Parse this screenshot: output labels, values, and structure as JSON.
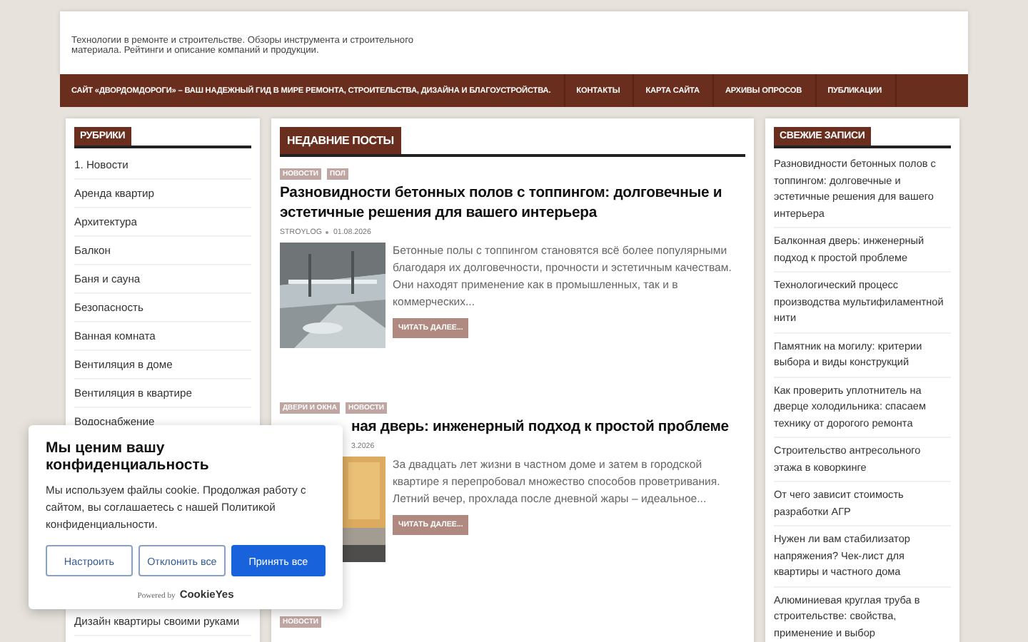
{
  "header": {
    "tagline": "Технологии в ремонте и строительстве. Обзоры инструмента и строительного материала. Рейтинги и описание компаний и продукции."
  },
  "nav": {
    "items": [
      {
        "label": "САЙТ «ДВОРДОМДОРОГИ» – ВАШ НАДЕЖНЫЙ ГИД В МИРЕ РЕМОНТА, СТРОИТЕЛЬСТВА, ДИЗАЙНА И БЛАГОУСТРОЙСТВА."
      },
      {
        "label": "КОНТАКТЫ"
      },
      {
        "label": "КАРТА САЙТА"
      },
      {
        "label": "АРХИВЫ ОПРОСОВ"
      },
      {
        "label": "ПУБЛИКАЦИИ"
      }
    ]
  },
  "rubrics": {
    "title": "РУБРИКИ",
    "items": [
      "1. Новости",
      "Аренда квартир",
      "Архитектура",
      "Балкон",
      "Баня и сауна",
      "Безопасность",
      "Ванная комната",
      "Вентиляция в доме",
      "Вентиляция в квартире",
      "Водоснабжение"
    ],
    "items_below_popup": [
      "Дизайн квартиры своими руками"
    ]
  },
  "recent_posts": {
    "title": "НЕДАВНИЕ ПОСТЫ",
    "posts": [
      {
        "covered": false,
        "tags": [
          "НОВОСТИ",
          "ПОЛ"
        ],
        "title": "Разновидности бетонных полов с топпингом: долговечные и эстетичные решения для вашего интерьера",
        "author": "STROYLOG",
        "date": "01.08.2026",
        "excerpt": "Бетонные полы с топпингом становятся всё более популярными благодаря их долговечности, прочности и эстетичным качествам. Они находят применение как в промышленных, так и в коммерческих...",
        "button": "ЧИТАТЬ ДАЛЕЕ..."
      },
      {
        "covered": true,
        "tags": [
          "ДВЕРИ И ОКНА",
          "НОВОСТИ"
        ],
        "title": "ная дверь: инженерный подход к простой проблеме",
        "date": "3.2026",
        "excerpt": "За двадцать лет жизни в частном доме и затем в городской квартире я перепробовал множество способов проветривания. Летний вечер, прохлада после дневной жары – идеальное...",
        "button": "ЧИТАТЬ ДАЛЕЕ..."
      },
      {
        "covered": false,
        "tags": [
          "НОВОСТИ"
        ]
      }
    ]
  },
  "fresh_posts": {
    "title": "СВЕЖИЕ ЗАПИСИ",
    "items": [
      "Разновидности бетонных полов с топпингом: долговечные и эстетичные решения для вашего интерьера",
      "Балконная дверь: инженерный подход к простой проблеме",
      "Технологический процесс производства мультифиламентной нити",
      "Памятник на могилу: критерии выбора и виды конструкций",
      "Как проверить уплотнитель на дверце холодильника: спасаем технику от дорогого ремонта",
      "Строительство антресольного этажа в коворкинге",
      "От чего зависит стоимость разработки АГР",
      "Нужен ли вам стабилизатор напряжения? Чек-лист для квартиры и частного дома",
      "Алюминиевая круглая труба в строительстве: свойства, применение и выбор"
    ]
  },
  "cookie_banner": {
    "title": "Мы ценим вашу конфиденциальность",
    "text": "Мы используем файлы cookie. Продолжая работу с сайтом, вы соглашаетесь с нашей Политикой конфиденциальности.",
    "buttons": [
      {
        "label": "Настроить",
        "kind": "outline"
      },
      {
        "label": "Отклонить все",
        "kind": "outline"
      },
      {
        "label": "Принять все",
        "kind": "primary"
      }
    ],
    "powered_by": "Powered by",
    "brand": "CookieYes"
  }
}
